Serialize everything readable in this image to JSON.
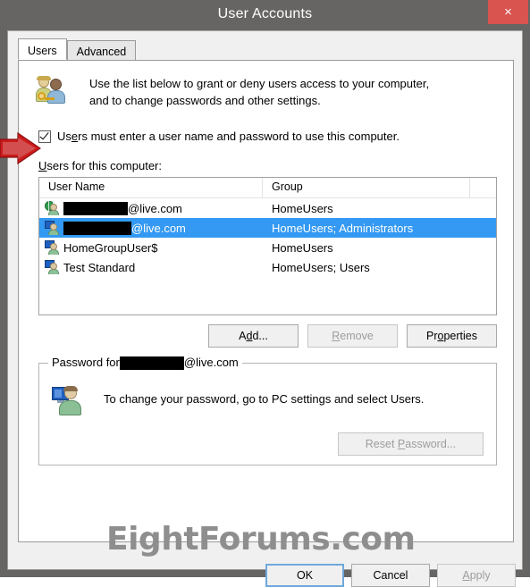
{
  "window": {
    "title": "User Accounts",
    "close_label": "×",
    "close_icon": "close-icon"
  },
  "tabs": [
    {
      "label": "Users",
      "active": true
    },
    {
      "label": "Advanced",
      "active": false
    }
  ],
  "description": {
    "icon": "users-with-key-icon",
    "text_line1": "Use the list below to grant or deny users access to your computer,",
    "text_line2": "and to change passwords and other settings.",
    "accelerator": "g"
  },
  "require_password_checkbox": {
    "label": "Users must enter a user name and password to use this computer.",
    "checked": true,
    "accelerator": "e"
  },
  "annotation": {
    "type": "red-arrow",
    "color": "#cc1b1b",
    "points_to": "require-password-checkbox"
  },
  "users_list": {
    "label": "Users for this computer:",
    "columns": [
      "User Name",
      "Group",
      ""
    ],
    "rows": [
      {
        "icon": "globe-account-icon",
        "redacted": true,
        "redacted_width": 72,
        "user_name_suffix": "@live.com",
        "group": "HomeUsers",
        "selected": false
      },
      {
        "icon": "local-account-icon",
        "redacted": true,
        "redacted_width": 76,
        "user_name_suffix": "@live.com",
        "group": "HomeUsers; Administrators",
        "selected": true
      },
      {
        "icon": "local-account-icon",
        "redacted": false,
        "user_name_suffix": "HomeGroupUser$",
        "group": "HomeUsers",
        "selected": false
      },
      {
        "icon": "local-account-icon",
        "redacted": false,
        "user_name_suffix": "Test Standard",
        "group": "HomeUsers; Users",
        "selected": false
      }
    ],
    "selection_color": "#3399f2"
  },
  "list_buttons": [
    {
      "label": "Add...",
      "enabled": true
    },
    {
      "label": "Remove",
      "enabled": false
    },
    {
      "label": "Properties",
      "enabled": true
    }
  ],
  "password_group": {
    "title_prefix": "Password for",
    "title_redacted": true,
    "title_suffix": "@live.com",
    "icon": "pc-user-icon",
    "text": "To change your password, go to PC settings and select Users.",
    "reset_button": {
      "label": "Reset Password...",
      "enabled": false
    }
  },
  "watermark": {
    "text": "EightForums.com",
    "color": "#8e8e8e"
  },
  "dialog_buttons": [
    {
      "label": "OK",
      "enabled": true,
      "default": true
    },
    {
      "label": "Cancel",
      "enabled": true,
      "default": false
    },
    {
      "label": "Apply",
      "enabled": false,
      "default": false
    }
  ]
}
